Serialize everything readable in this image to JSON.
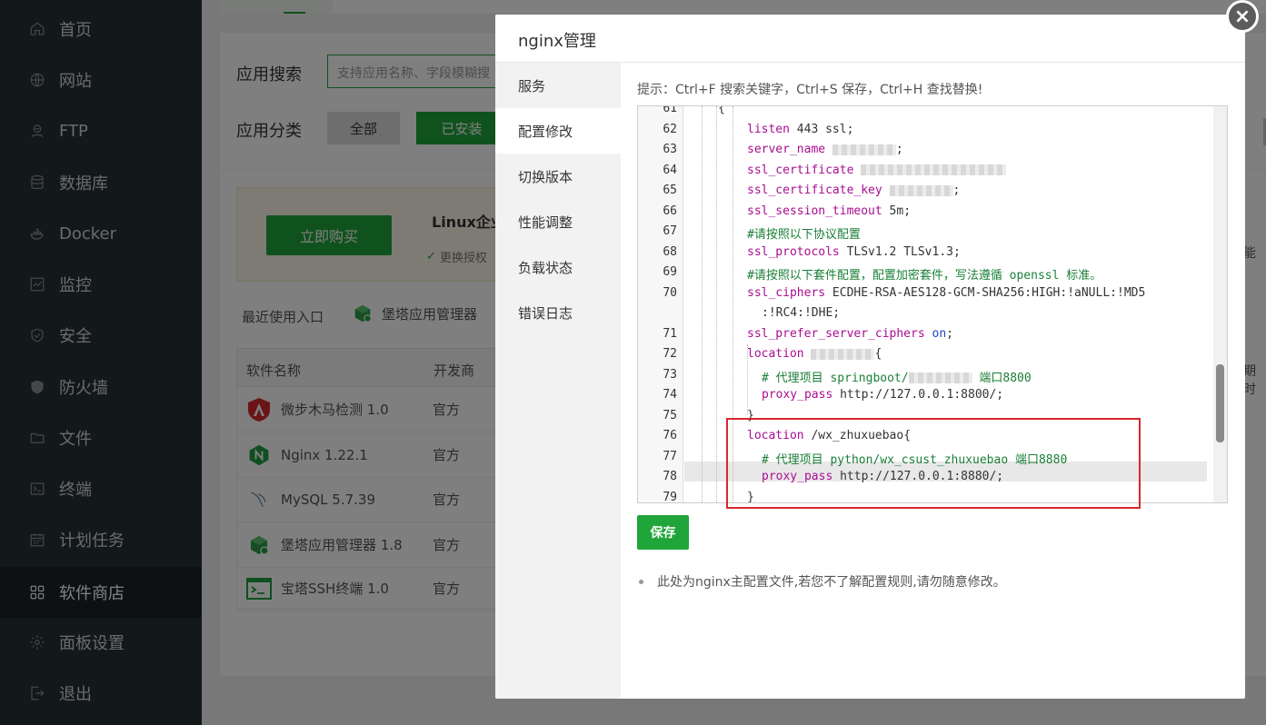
{
  "sidebar": {
    "items": [
      {
        "label": "首页",
        "icon": "home-icon"
      },
      {
        "label": "网站",
        "icon": "globe-icon"
      },
      {
        "label": "FTP",
        "icon": "ftp-icon"
      },
      {
        "label": "数据库",
        "icon": "database-icon"
      },
      {
        "label": "Docker",
        "icon": "docker-icon"
      },
      {
        "label": "监控",
        "icon": "monitor-icon"
      },
      {
        "label": "安全",
        "icon": "shield-icon"
      },
      {
        "label": "防火墙",
        "icon": "firewall-icon"
      },
      {
        "label": "文件",
        "icon": "folder-icon"
      },
      {
        "label": "终端",
        "icon": "terminal-icon"
      },
      {
        "label": "计划任务",
        "icon": "calendar-icon"
      },
      {
        "label": "软件商店",
        "icon": "grid-icon",
        "active": true
      },
      {
        "label": "面板设置",
        "icon": "gear-icon"
      },
      {
        "label": "退出",
        "icon": "logout-icon"
      }
    ]
  },
  "store": {
    "search_label": "应用搜索",
    "search_placeholder": "支持应用名称、字段模糊搜",
    "category_label": "应用分类",
    "category_all": "全部",
    "category_installed": "已安装",
    "promo_title": "Linux企业",
    "promo_buy": "立即购买",
    "promo_feature": "更换授权",
    "recent_label": "最近使用入口",
    "recent_app": "堡塔应用管理器",
    "table_headers": [
      "软件名称",
      "开发商"
    ],
    "rows": [
      {
        "name": "微步木马检测 1.0",
        "dev": "官方"
      },
      {
        "name": "Nginx 1.22.1",
        "dev": "官方"
      },
      {
        "name": "MySQL 5.7.39",
        "dev": "官方"
      },
      {
        "name": "堡塔应用管理器 1.8",
        "dev": "官方"
      },
      {
        "name": "宝塔SSH终端 1.0",
        "dev": "官方"
      }
    ],
    "right_cut_1": "能",
    "right_cut_2": "期时"
  },
  "modal": {
    "title": "nginx管理",
    "menu": [
      {
        "label": "服务"
      },
      {
        "label": "配置修改",
        "active": true
      },
      {
        "label": "切换版本"
      },
      {
        "label": "性能调整"
      },
      {
        "label": "负载状态"
      },
      {
        "label": "错误日志"
      }
    ],
    "tip": "提示：Ctrl+F 搜索关键字，Ctrl+S 保存，Ctrl+H 查找替换!",
    "save": "保存",
    "note": "此处为nginx主配置文件,若您不了解配置规则,请勿随意修改。",
    "close": "×"
  },
  "editor": {
    "lines": [
      {
        "n": "61",
        "text": "{"
      },
      {
        "n": "62",
        "key": "listen",
        "rest": " 443 ssl;"
      },
      {
        "n": "63",
        "key": "server_name",
        "rest": " ",
        "blur": true,
        "tail": ";"
      },
      {
        "n": "64",
        "key": "ssl_certificate",
        "rest": " ",
        "blur": true,
        "tail": ""
      },
      {
        "n": "65",
        "key": "ssl_certificate_key",
        "rest": " ",
        "blur": true,
        "tail": ";"
      },
      {
        "n": "66",
        "key": "ssl_session_timeout",
        "rest": " 5m;"
      },
      {
        "n": "67",
        "comment": "#请按照以下协议配置"
      },
      {
        "n": "68",
        "key": "ssl_protocols",
        "rest": " TLSv1.2 TLSv1.3;"
      },
      {
        "n": "69",
        "comment": "#请按照以下套件配置，配置加密套件，写法遵循 openssl 标准。"
      },
      {
        "n": "70",
        "key": "ssl_ciphers",
        "rest": " ECDHE-RSA-AES128-GCM-SHA256:HIGH:!aNULL:!MD5"
      },
      {
        "n": "",
        "cont": ":!RC4:!DHE;"
      },
      {
        "n": "71",
        "key": "ssl_prefer_server_ciphers",
        "rest": " ",
        "on": "on",
        "tail": ";"
      },
      {
        "n": "72",
        "key": "location",
        "rest": " ",
        "blur": true,
        "tail": "{"
      },
      {
        "n": "73",
        "comment": "# 代理项目 springboot/",
        "blur": true,
        "comment_tail": " 端口8800"
      },
      {
        "n": "74",
        "key": "proxy_pass",
        "rest": " http://127.0.0.1:8800/;"
      },
      {
        "n": "75",
        "text": "}"
      },
      {
        "n": "76",
        "key": "location",
        "rest": " /wx_zhuxuebao{"
      },
      {
        "n": "77",
        "comment": "# 代理项目 python/wx_csust_zhuxuebao 端口8880"
      },
      {
        "n": "78",
        "key": "proxy_pass",
        "rest": " http://127.0.0.1:8880/;"
      },
      {
        "n": "79",
        "text": "}"
      }
    ]
  }
}
